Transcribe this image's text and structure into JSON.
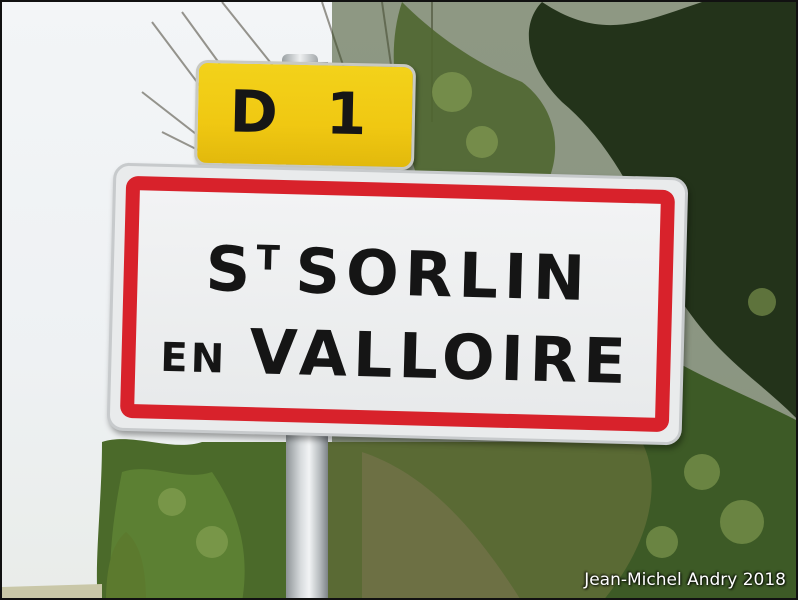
{
  "road_sign": {
    "label": "D 1"
  },
  "town_sign": {
    "line1_st_initial": "S",
    "line1_st_suffix": "T",
    "line1_name": "SORLIN",
    "line2_prefix": "EN",
    "line2_name": "VALLOIRE"
  },
  "credit": "Jean-Michel Andry 2018",
  "colors": {
    "sign_border": "#d8222b",
    "road_plate": "#f0c812",
    "foliage_dark": "#2e3d1e",
    "foliage_light": "#6f8a3a"
  }
}
